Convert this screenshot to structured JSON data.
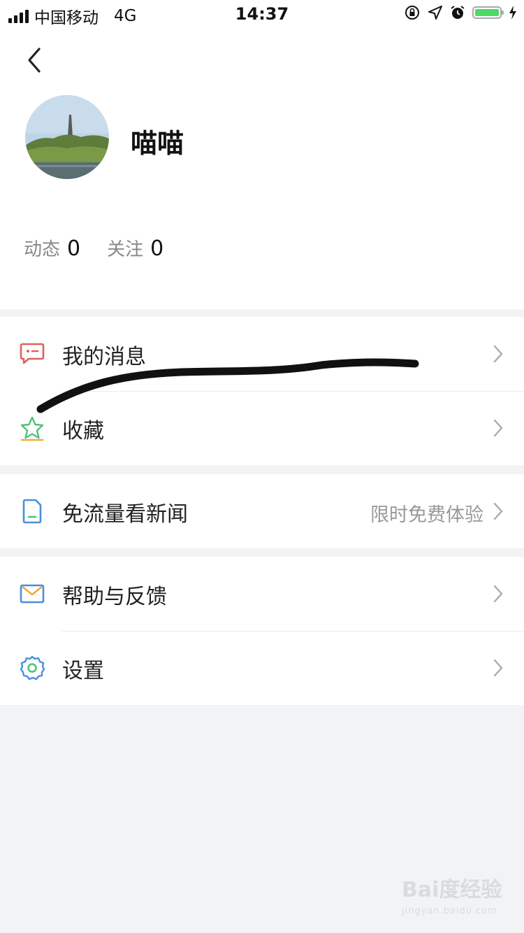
{
  "status_bar": {
    "carrier": "中国移动",
    "network": "4G",
    "time": "14:37"
  },
  "profile": {
    "username": "喵喵",
    "stats": [
      {
        "label": "动态",
        "value": "0"
      },
      {
        "label": "关注",
        "value": "0"
      }
    ]
  },
  "menu": {
    "messages": {
      "label": "我的消息",
      "icon": "message-icon",
      "color": "#e0605a"
    },
    "favorites": {
      "label": "收藏",
      "icon": "star-icon",
      "color": "#4cc37b"
    },
    "free_news": {
      "label": "免流量看新闻",
      "extra": "限时免费体验",
      "icon": "phone-icon",
      "color": "#4a8fe0"
    },
    "feedback": {
      "label": "帮助与反馈",
      "icon": "mail-icon",
      "color": "#4a8fe0"
    },
    "settings": {
      "label": "设置",
      "icon": "gear-icon",
      "color": "#4a8fe0"
    }
  },
  "watermark": {
    "brand": "Bai度经验",
    "url": "jingyan.baidu.com"
  }
}
